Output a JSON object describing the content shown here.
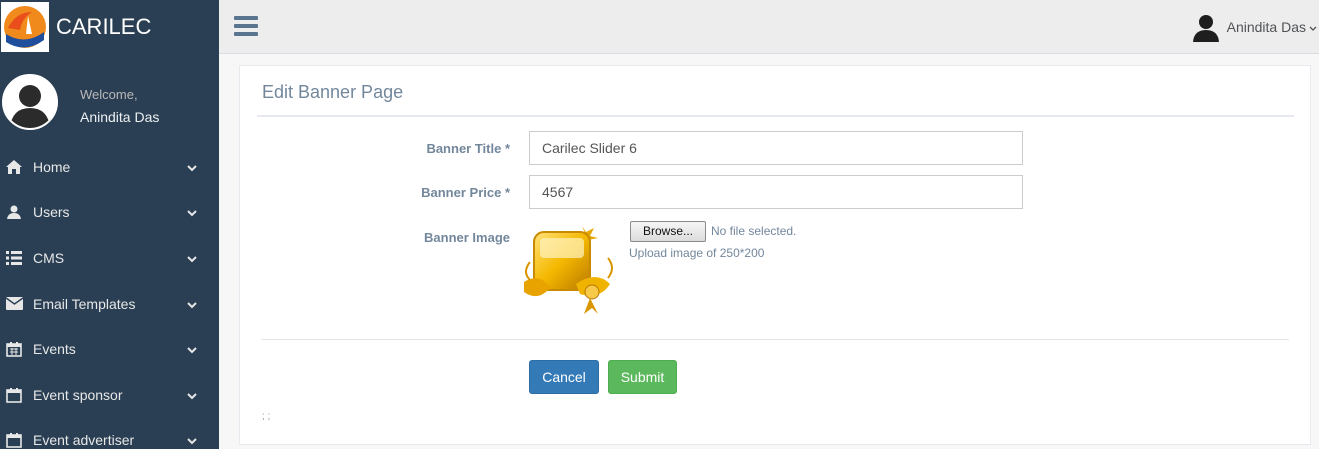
{
  "brand": {
    "name": "CARILEC"
  },
  "profile": {
    "welcome": "Welcome,",
    "name": "Anindita Das"
  },
  "sidebar": {
    "items": [
      {
        "label": "Home",
        "icon": "home-icon"
      },
      {
        "label": "Users",
        "icon": "user-icon"
      },
      {
        "label": "CMS",
        "icon": "list-icon"
      },
      {
        "label": "Email Templates",
        "icon": "envelope-icon"
      },
      {
        "label": "Events",
        "icon": "calendar-icon"
      },
      {
        "label": "Event sponsor",
        "icon": "calendar-icon"
      },
      {
        "label": "Event advertiser",
        "icon": "calendar-icon"
      }
    ]
  },
  "topnav": {
    "user_name": "Anindita Das"
  },
  "page": {
    "title": "Edit Banner Page",
    "fields": {
      "title_label": "Banner Title *",
      "title_value": "Carilec Slider 6",
      "price_label": "Banner Price *",
      "price_value": "4567",
      "image_label": "Banner Image",
      "browse_label": "Browse...",
      "no_file": "No file selected.",
      "upload_hint": "Upload image of 250*200"
    },
    "buttons": {
      "cancel": "Cancel",
      "submit": "Submit"
    },
    "footnote": "; ;"
  },
  "colors": {
    "sidebar": "#2a3f54",
    "primary": "#337ab7",
    "success": "#5cb85c"
  }
}
